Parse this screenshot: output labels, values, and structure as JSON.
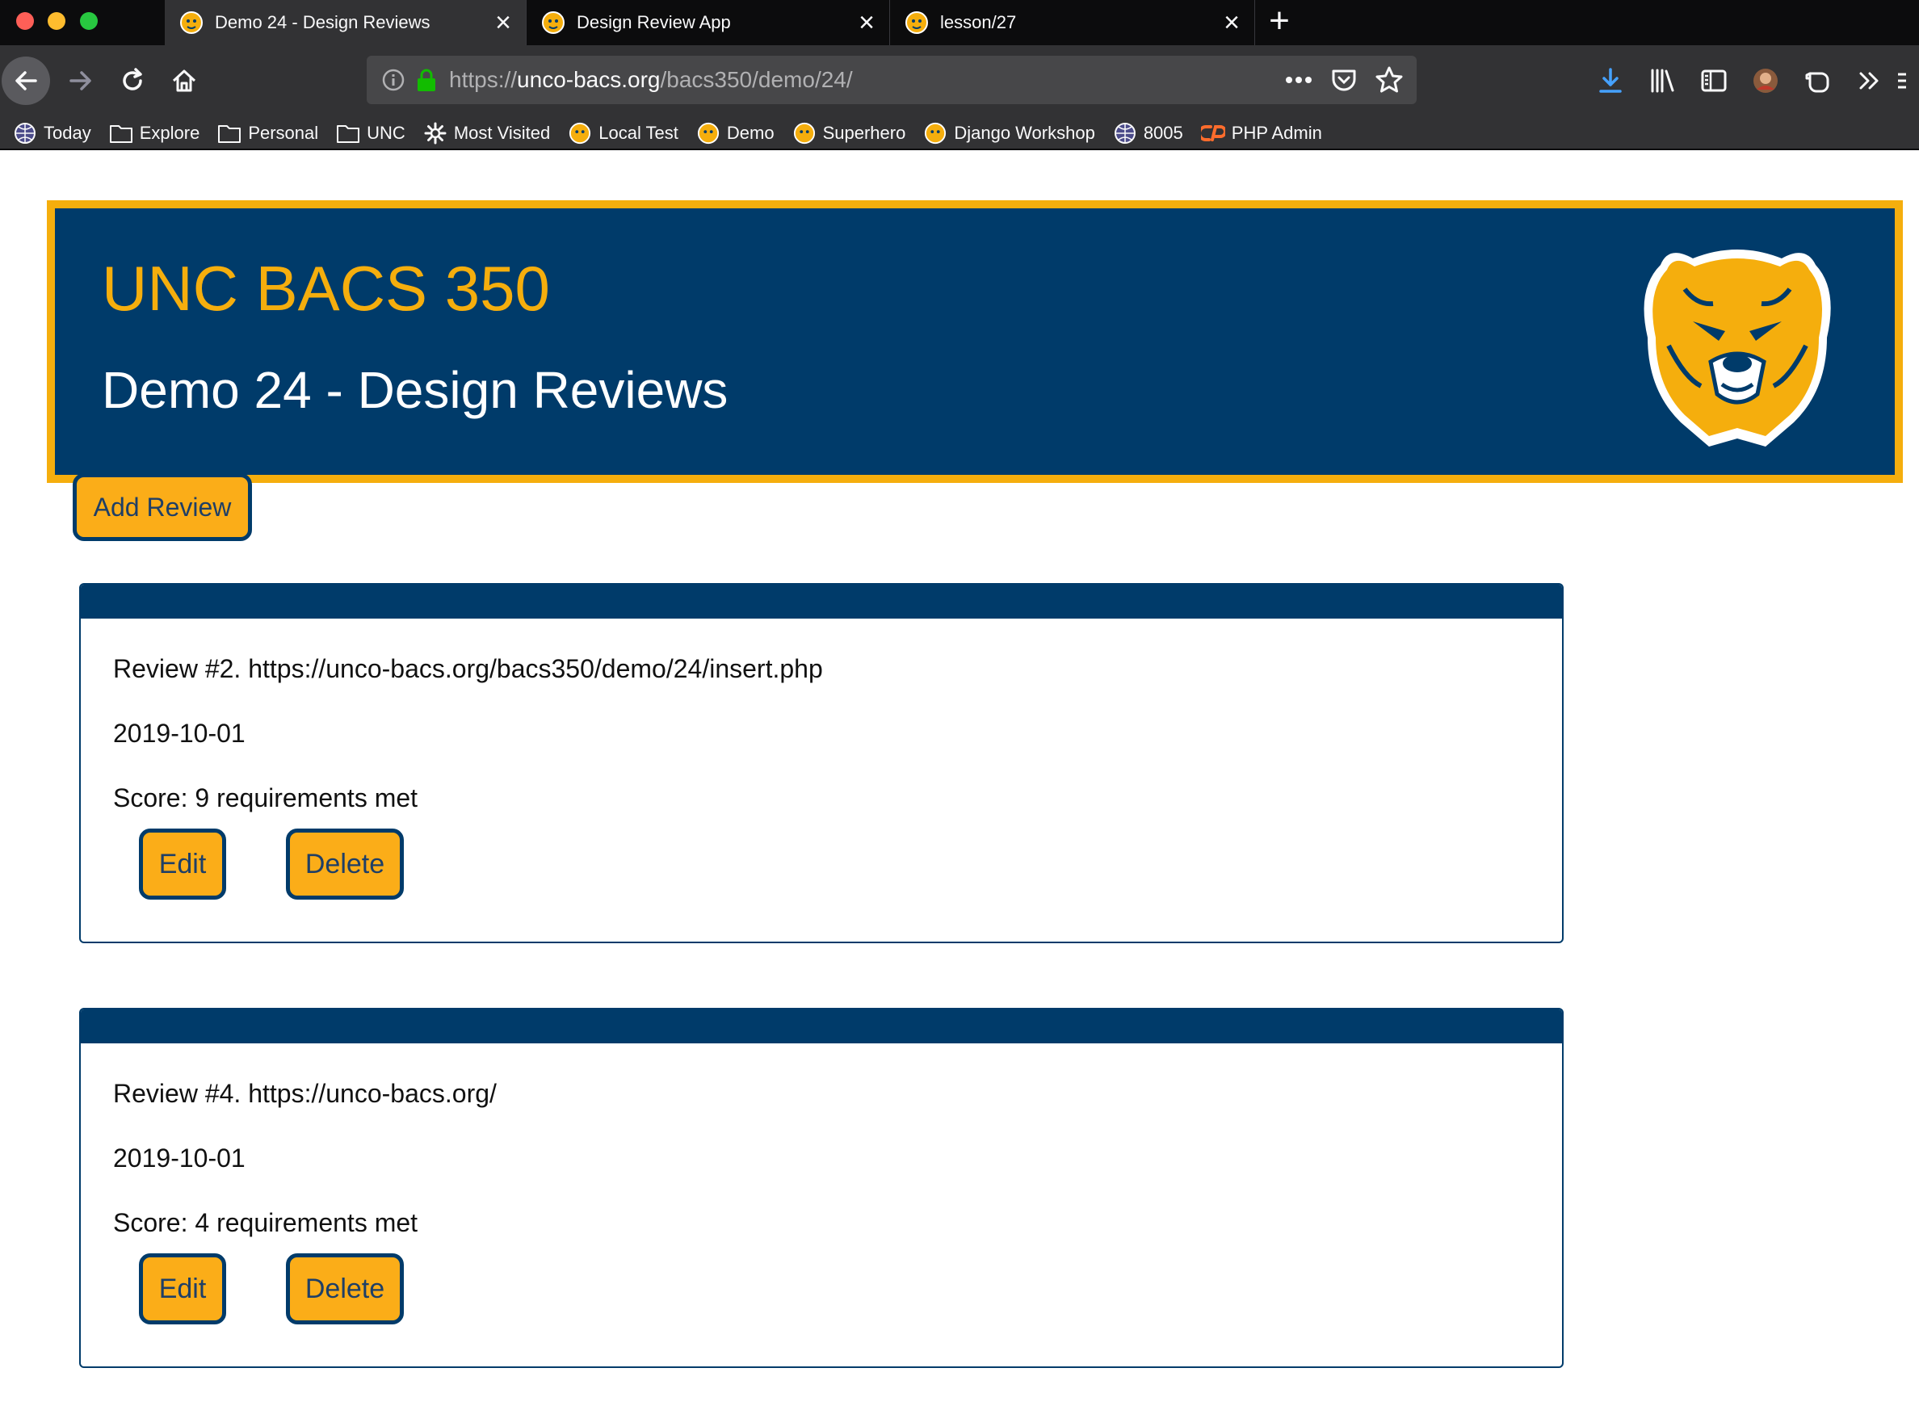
{
  "browser": {
    "tabs": [
      {
        "title": "Demo 24 - Design Reviews",
        "active": true
      },
      {
        "title": "Design Review App",
        "active": false
      },
      {
        "title": "lesson/27",
        "active": false
      }
    ],
    "url": {
      "scheme": "https://",
      "host": "unco-bacs.org",
      "path": "/bacs350/demo/24/"
    },
    "bookmarks": [
      "Today",
      "Explore",
      "Personal",
      "UNC",
      "Most Visited",
      "Local Test",
      "Demo",
      "Superhero",
      "Django Workshop",
      "8005",
      "PHP Admin"
    ]
  },
  "header": {
    "site_title": "UNC BACS 350",
    "page_title": "Demo 24 - Design Reviews"
  },
  "actions": {
    "add_review_label": "Add Review"
  },
  "reviews": [
    {
      "title": "Review #2. https://unco-bacs.org/bacs350/demo/24/insert.php",
      "date": "2019-10-01",
      "score": "Score: 9 requirements met",
      "edit_label": "Edit",
      "delete_label": "Delete"
    },
    {
      "title": "Review #4. https://unco-bacs.org/",
      "date": "2019-10-01",
      "score": "Score: 4 requirements met",
      "edit_label": "Edit",
      "delete_label": "Delete"
    }
  ],
  "colors": {
    "unc_navy": "#003b6a",
    "unc_gold": "#f5ae0d",
    "button_gold": "#fbad18"
  }
}
